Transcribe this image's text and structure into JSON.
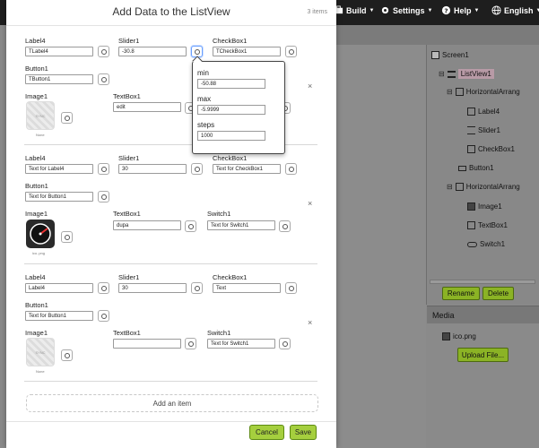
{
  "app": {
    "menu": [
      {
        "icon": "build-icon",
        "label": "Build"
      },
      {
        "icon": "gear-icon",
        "label": "Settings"
      },
      {
        "icon": "help-icon",
        "label": "Help"
      },
      {
        "icon": "globe-icon",
        "label": "English"
      }
    ],
    "components": {
      "items": [
        {
          "icon": "screen-icon",
          "label": "Screen1"
        },
        {
          "icon": "listview-icon",
          "label": "ListView1"
        },
        {
          "icon": "horizontal-arrangement-icon",
          "label": "HorizontalArrang"
        },
        {
          "icon": "label-icon",
          "label": "Label4"
        },
        {
          "icon": "slider-icon",
          "label": "Slider1"
        },
        {
          "icon": "checkbox-icon",
          "label": "CheckBox1"
        },
        {
          "icon": "button-icon",
          "label": "Button1"
        },
        {
          "icon": "horizontal-arrangement-icon",
          "label": "HorizontalArrang"
        },
        {
          "icon": "image-icon",
          "label": "Image1"
        },
        {
          "icon": "textbox-icon",
          "label": "TextBox1"
        },
        {
          "icon": "switch-icon",
          "label": "Switch1"
        }
      ],
      "rename_label": "Rename",
      "delete_label": "Delete"
    },
    "media": {
      "title": "Media",
      "file": "ico.png",
      "upload_label": "Upload File..."
    }
  },
  "modal": {
    "title": "Add Data to the ListView",
    "count": "3 items",
    "field_labels": {
      "label": "Label4",
      "slider": "Slider1",
      "checkbox": "CheckBox1",
      "button": "Button1",
      "image": "Image1",
      "textbox": "TextBox1",
      "switch": "Switch1"
    },
    "items": [
      {
        "label": "TLabel4",
        "slider": "-30.8",
        "checkbox": "TCheckBox1",
        "button": "TButton1",
        "image_placeholder": "SYNC",
        "image_caption": "None",
        "textbox": "edit",
        "remove": "×"
      },
      {
        "label": "Text for Label4",
        "slider": "30",
        "checkbox": "Text for CheckBox1",
        "button": "Text for Button1",
        "image_caption": "ico..png",
        "textbox": "dupa",
        "switch": "Text for Switch1",
        "remove": "×"
      },
      {
        "label": "Label4",
        "slider": "30",
        "checkbox": "Text",
        "button": "Text for Button1",
        "image_placeholder": "SYNC",
        "image_caption": "None",
        "textbox": "",
        "switch": "Text for Switch1",
        "remove": "×"
      }
    ],
    "add_item_label": "Add an item",
    "cancel_label": "Cancel",
    "save_label": "Save"
  },
  "slider_popover": {
    "min_label": "min",
    "min_value": "-50.88",
    "max_label": "max",
    "max_value": "-5.9999",
    "steps_label": "steps",
    "steps_value": "1000"
  },
  "colors": {
    "accent_green": "#a5cf3e",
    "selected_tree": "#b89aa6"
  }
}
